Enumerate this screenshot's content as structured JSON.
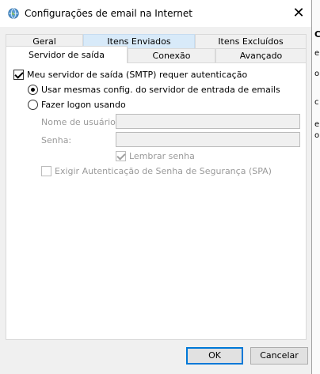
{
  "window": {
    "title": "Configurações de email na Internet",
    "close_glyph": "✕"
  },
  "tabs_row1": [
    "Geral",
    "Itens Enviados",
    "Itens Excluídos"
  ],
  "tabs_row2": [
    "Servidor de saída",
    "Conexão",
    "Avançado"
  ],
  "active_tab": "Servidor de saída",
  "panel": {
    "smtp_auth_label": "Meu servidor de saída (SMTP) requer autenticação",
    "smtp_auth_checked": true,
    "use_same_label": "Usar mesmas config. do servidor de entrada de emails",
    "use_same_selected": true,
    "logon_label": "Fazer logon usando",
    "logon_selected": false,
    "username_label": "Nome de usuário:",
    "username_value": "",
    "password_label": "Senha:",
    "password_value": "",
    "remember_label": "Lembrar senha",
    "remember_checked": true,
    "spa_label": "Exigir Autenticação de Senha de Segurança (SPA)",
    "spa_checked": false
  },
  "buttons": {
    "ok": "OK",
    "cancel": "Cancelar"
  },
  "background_window_fragments": [
    "C",
    "e",
    "o",
    "c",
    "e",
    "o"
  ],
  "colors": {
    "accent": "#0078d7",
    "hover_tab": "#d8eaf9"
  }
}
